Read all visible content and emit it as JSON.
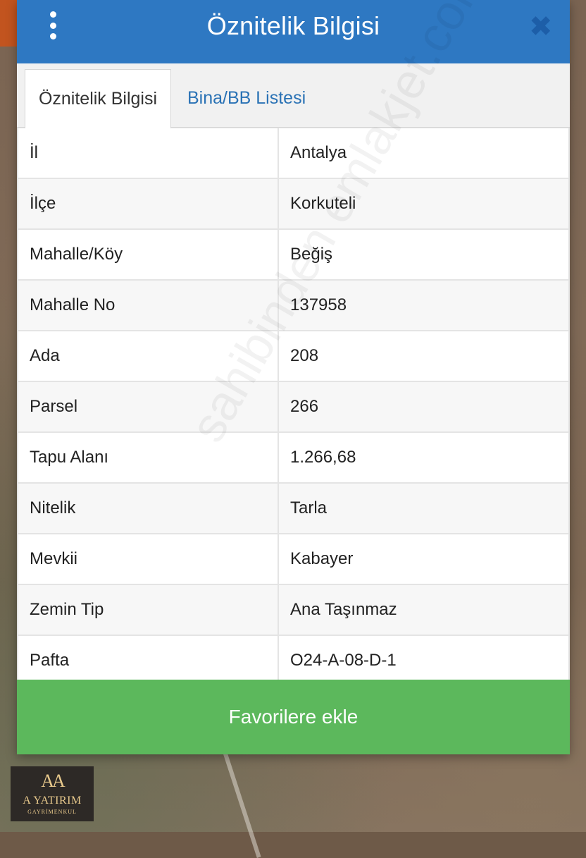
{
  "modal": {
    "title": "Öznitelik Bilgisi",
    "close_glyph": "✖",
    "menu_icon": "kebab-icon",
    "close_icon": "close-icon"
  },
  "tabs": [
    {
      "label": "Öznitelik Bilgisi",
      "active": true
    },
    {
      "label": "Bina/BB Listesi",
      "active": false
    }
  ],
  "attributes": [
    {
      "key": "İl",
      "value": "Antalya"
    },
    {
      "key": "İlçe",
      "value": "Korkuteli"
    },
    {
      "key": "Mahalle/Köy",
      "value": "Beğiş"
    },
    {
      "key": "Mahalle No",
      "value": "137958"
    },
    {
      "key": "Ada",
      "value": "208"
    },
    {
      "key": "Parsel",
      "value": "266"
    },
    {
      "key": "Tapu Alanı",
      "value": "1.266,68"
    },
    {
      "key": "Nitelik",
      "value": "Tarla"
    },
    {
      "key": "Mevkii",
      "value": "Kabayer"
    },
    {
      "key": "Zemin Tip",
      "value": "Ana Taşınmaz"
    },
    {
      "key": "Pafta",
      "value": "O24-A-08-D-1"
    }
  ],
  "favorite_button": {
    "label": "Favorilere ekle"
  },
  "logo": {
    "mark": "AA",
    "name": "A YATIRIM",
    "sub": "GAYRİMENKUL"
  },
  "watermark": "sahibinden emlakjet.com",
  "colors": {
    "header": "#2e78c2",
    "favorite_button": "#5cb85c",
    "tab_link": "#2a72b5"
  }
}
